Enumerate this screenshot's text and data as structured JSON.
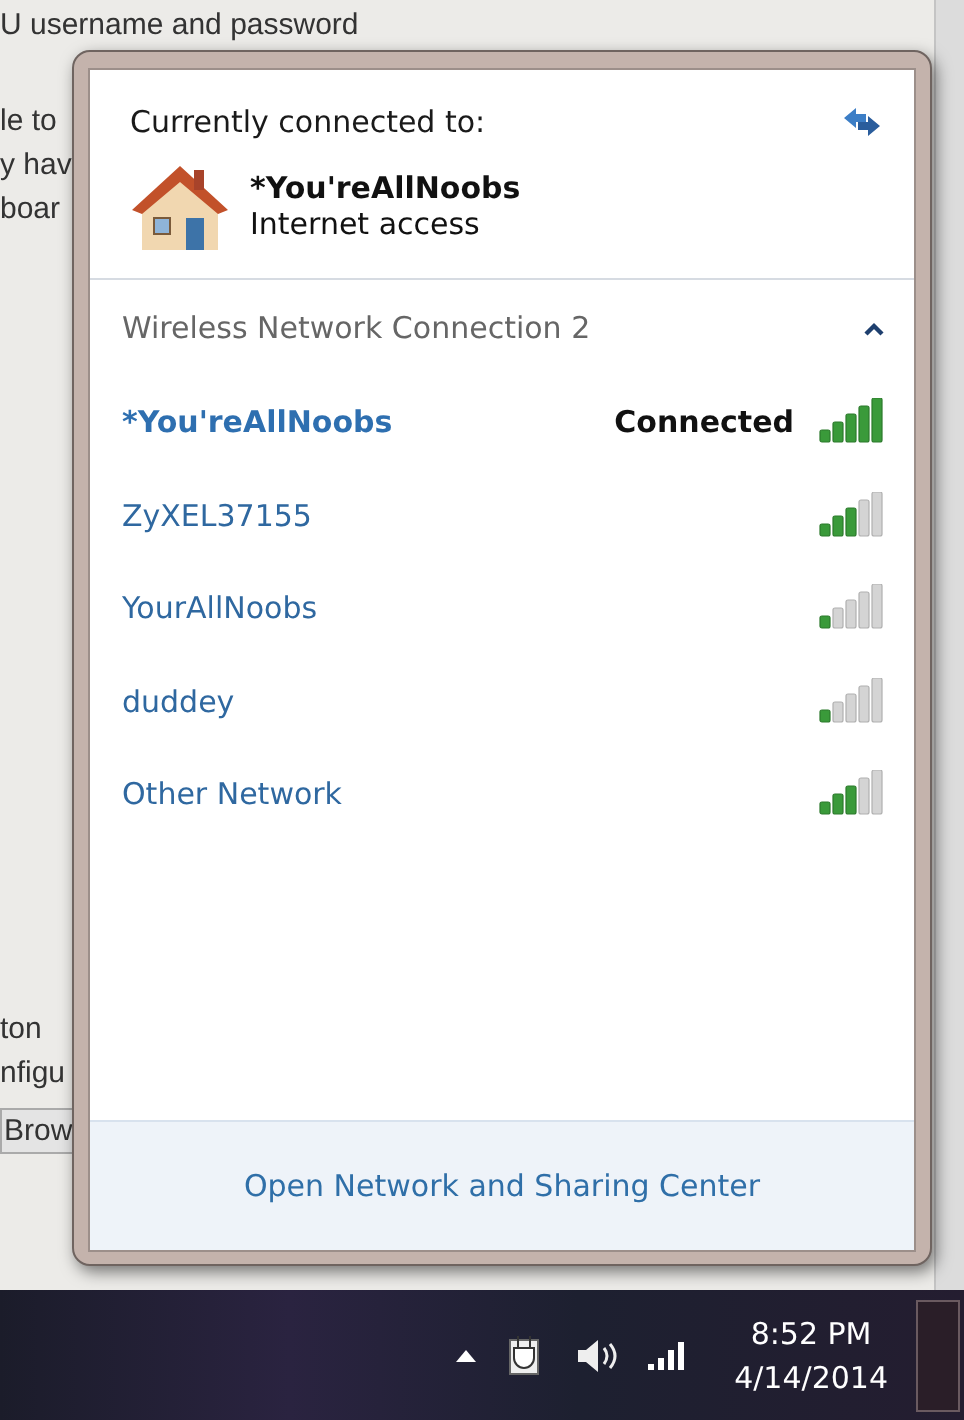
{
  "background_window": {
    "texts": [
      {
        "text": "U username and password",
        "kind": "line"
      },
      {
        "text": "le to",
        "kind": "line"
      },
      {
        "text": "y hav",
        "kind": "line"
      },
      {
        "text": "boar",
        "kind": "line"
      },
      {
        "text": "ton",
        "kind": "lower"
      },
      {
        "text": "nfigu",
        "kind": "line"
      },
      {
        "text": "Brow",
        "kind": "button"
      }
    ]
  },
  "network_popup": {
    "heading": "Currently connected to:",
    "current_connection": {
      "name": "*You'reAllNoobs",
      "status": "Internet access"
    },
    "section": {
      "title": "Wireless Network Connection 2",
      "expanded": true,
      "networks": [
        {
          "name": "*You'reAllNoobs",
          "status": "Connected",
          "selected": true,
          "level": 1
        },
        {
          "name": "ZyXEL37155",
          "selected": false,
          "level": 0.6
        },
        {
          "name": "YourAllNoobs",
          "selected": false,
          "level": 0.2
        },
        {
          "name": "duddey",
          "selected": false,
          "level": 0.2
        },
        {
          "name": "Other Network",
          "selected": false,
          "level": 0.6
        }
      ]
    },
    "footer_link": "Open Network and Sharing Center"
  },
  "taskbar": {
    "time": "8:52 PM",
    "date": "4/14/2014"
  }
}
